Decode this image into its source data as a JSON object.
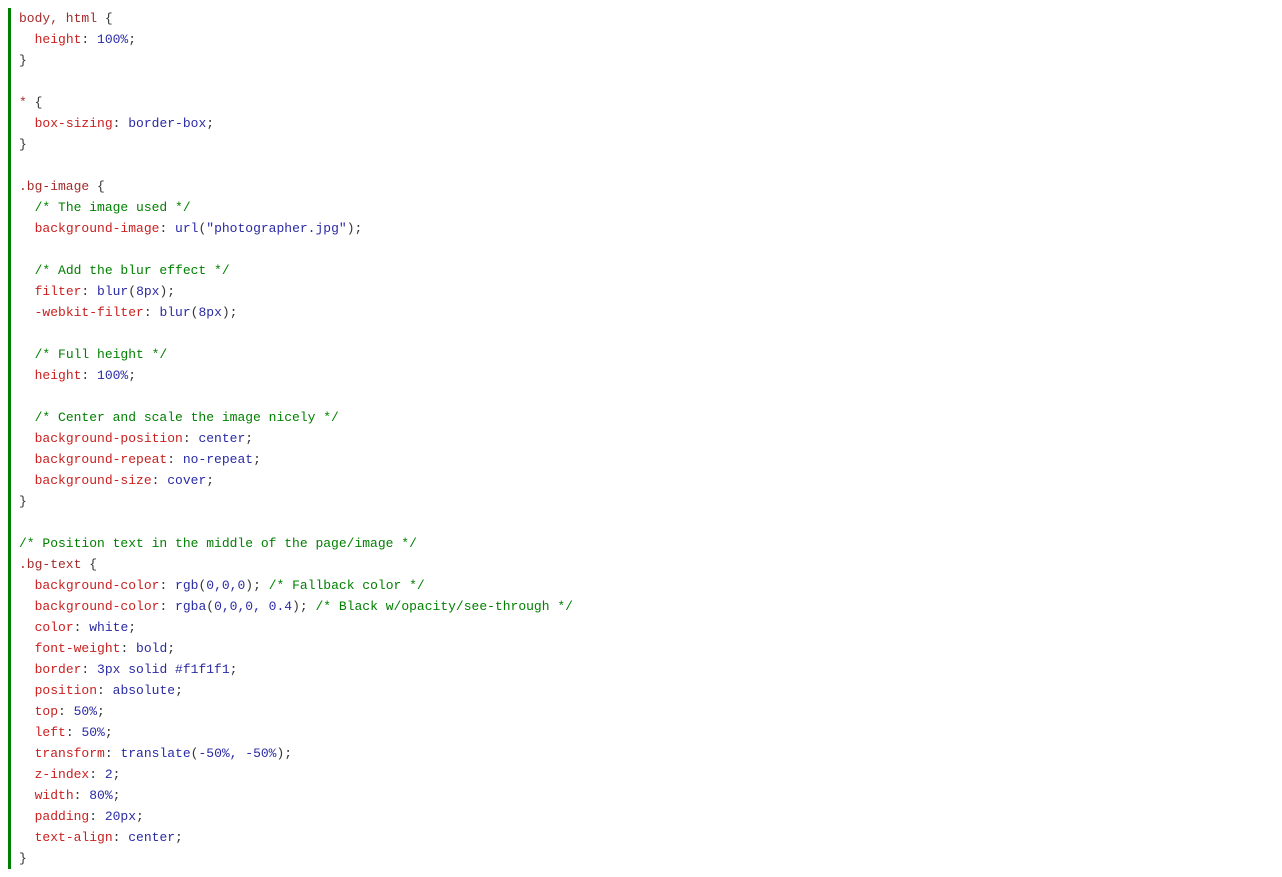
{
  "code": {
    "lines": [
      [
        {
          "cls": "t-selector",
          "text": "body, html"
        },
        {
          "cls": "t-punct",
          "text": " {"
        }
      ],
      [
        {
          "cls": "t-punct",
          "text": "  "
        },
        {
          "cls": "t-prop",
          "text": "height"
        },
        {
          "cls": "t-punct",
          "text": ": "
        },
        {
          "cls": "t-value",
          "text": "100%"
        },
        {
          "cls": "t-punct",
          "text": ";"
        }
      ],
      [
        {
          "cls": "t-punct",
          "text": "}"
        }
      ],
      [
        {
          "cls": "t-punct",
          "text": ""
        }
      ],
      [
        {
          "cls": "t-selector",
          "text": "*"
        },
        {
          "cls": "t-punct",
          "text": " {"
        }
      ],
      [
        {
          "cls": "t-punct",
          "text": "  "
        },
        {
          "cls": "t-prop",
          "text": "box-sizing"
        },
        {
          "cls": "t-punct",
          "text": ": "
        },
        {
          "cls": "t-value",
          "text": "border-box"
        },
        {
          "cls": "t-punct",
          "text": ";"
        }
      ],
      [
        {
          "cls": "t-punct",
          "text": "}"
        }
      ],
      [
        {
          "cls": "t-punct",
          "text": ""
        }
      ],
      [
        {
          "cls": "t-selector",
          "text": ".bg-image"
        },
        {
          "cls": "t-punct",
          "text": " {"
        }
      ],
      [
        {
          "cls": "t-punct",
          "text": "  "
        },
        {
          "cls": "t-comment",
          "text": "/* The image used */"
        }
      ],
      [
        {
          "cls": "t-punct",
          "text": "  "
        },
        {
          "cls": "t-prop",
          "text": "background-image"
        },
        {
          "cls": "t-punct",
          "text": ": "
        },
        {
          "cls": "t-value",
          "text": "url"
        },
        {
          "cls": "t-punct",
          "text": "("
        },
        {
          "cls": "t-string",
          "text": "\"photographer.jpg\""
        },
        {
          "cls": "t-punct",
          "text": ");"
        }
      ],
      [
        {
          "cls": "t-punct",
          "text": ""
        }
      ],
      [
        {
          "cls": "t-punct",
          "text": "  "
        },
        {
          "cls": "t-comment",
          "text": "/* Add the blur effect */"
        }
      ],
      [
        {
          "cls": "t-punct",
          "text": "  "
        },
        {
          "cls": "t-prop",
          "text": "filter"
        },
        {
          "cls": "t-punct",
          "text": ": "
        },
        {
          "cls": "t-value",
          "text": "blur"
        },
        {
          "cls": "t-punct",
          "text": "("
        },
        {
          "cls": "t-value",
          "text": "8px"
        },
        {
          "cls": "t-punct",
          "text": ");"
        }
      ],
      [
        {
          "cls": "t-punct",
          "text": "  "
        },
        {
          "cls": "t-prop",
          "text": "-webkit-filter"
        },
        {
          "cls": "t-punct",
          "text": ": "
        },
        {
          "cls": "t-value",
          "text": "blur"
        },
        {
          "cls": "t-punct",
          "text": "("
        },
        {
          "cls": "t-value",
          "text": "8px"
        },
        {
          "cls": "t-punct",
          "text": ");"
        }
      ],
      [
        {
          "cls": "t-punct",
          "text": ""
        }
      ],
      [
        {
          "cls": "t-punct",
          "text": "  "
        },
        {
          "cls": "t-comment",
          "text": "/* Full height */"
        }
      ],
      [
        {
          "cls": "t-punct",
          "text": "  "
        },
        {
          "cls": "t-prop",
          "text": "height"
        },
        {
          "cls": "t-punct",
          "text": ": "
        },
        {
          "cls": "t-value",
          "text": "100%"
        },
        {
          "cls": "t-punct",
          "text": ";"
        }
      ],
      [
        {
          "cls": "t-punct",
          "text": ""
        }
      ],
      [
        {
          "cls": "t-punct",
          "text": "  "
        },
        {
          "cls": "t-comment",
          "text": "/* Center and scale the image nicely */"
        }
      ],
      [
        {
          "cls": "t-punct",
          "text": "  "
        },
        {
          "cls": "t-prop",
          "text": "background-position"
        },
        {
          "cls": "t-punct",
          "text": ": "
        },
        {
          "cls": "t-value",
          "text": "center"
        },
        {
          "cls": "t-punct",
          "text": ";"
        }
      ],
      [
        {
          "cls": "t-punct",
          "text": "  "
        },
        {
          "cls": "t-prop",
          "text": "background-repeat"
        },
        {
          "cls": "t-punct",
          "text": ": "
        },
        {
          "cls": "t-value",
          "text": "no-repeat"
        },
        {
          "cls": "t-punct",
          "text": ";"
        }
      ],
      [
        {
          "cls": "t-punct",
          "text": "  "
        },
        {
          "cls": "t-prop",
          "text": "background-size"
        },
        {
          "cls": "t-punct",
          "text": ": "
        },
        {
          "cls": "t-value",
          "text": "cover"
        },
        {
          "cls": "t-punct",
          "text": ";"
        }
      ],
      [
        {
          "cls": "t-punct",
          "text": "}"
        }
      ],
      [
        {
          "cls": "t-punct",
          "text": ""
        }
      ],
      [
        {
          "cls": "t-comment",
          "text": "/* Position text in the middle of the page/image */"
        }
      ],
      [
        {
          "cls": "t-selector",
          "text": ".bg-text"
        },
        {
          "cls": "t-punct",
          "text": " {"
        }
      ],
      [
        {
          "cls": "t-punct",
          "text": "  "
        },
        {
          "cls": "t-prop",
          "text": "background-color"
        },
        {
          "cls": "t-punct",
          "text": ": "
        },
        {
          "cls": "t-value",
          "text": "rgb"
        },
        {
          "cls": "t-punct",
          "text": "("
        },
        {
          "cls": "t-value",
          "text": "0,0,0"
        },
        {
          "cls": "t-punct",
          "text": "); "
        },
        {
          "cls": "t-comment",
          "text": "/* Fallback color */"
        }
      ],
      [
        {
          "cls": "t-punct",
          "text": "  "
        },
        {
          "cls": "t-prop",
          "text": "background-color"
        },
        {
          "cls": "t-punct",
          "text": ": "
        },
        {
          "cls": "t-value",
          "text": "rgba"
        },
        {
          "cls": "t-punct",
          "text": "("
        },
        {
          "cls": "t-value",
          "text": "0,0,0, 0.4"
        },
        {
          "cls": "t-punct",
          "text": "); "
        },
        {
          "cls": "t-comment",
          "text": "/* Black w/opacity/see-through */"
        }
      ],
      [
        {
          "cls": "t-punct",
          "text": "  "
        },
        {
          "cls": "t-prop",
          "text": "color"
        },
        {
          "cls": "t-punct",
          "text": ": "
        },
        {
          "cls": "t-value",
          "text": "white"
        },
        {
          "cls": "t-punct",
          "text": ";"
        }
      ],
      [
        {
          "cls": "t-punct",
          "text": "  "
        },
        {
          "cls": "t-prop",
          "text": "font-weight"
        },
        {
          "cls": "t-punct",
          "text": ": "
        },
        {
          "cls": "t-value",
          "text": "bold"
        },
        {
          "cls": "t-punct",
          "text": ";"
        }
      ],
      [
        {
          "cls": "t-punct",
          "text": "  "
        },
        {
          "cls": "t-prop",
          "text": "border"
        },
        {
          "cls": "t-punct",
          "text": ": "
        },
        {
          "cls": "t-value",
          "text": "3px solid #f1f1f1"
        },
        {
          "cls": "t-punct",
          "text": ";"
        }
      ],
      [
        {
          "cls": "t-punct",
          "text": "  "
        },
        {
          "cls": "t-prop",
          "text": "position"
        },
        {
          "cls": "t-punct",
          "text": ": "
        },
        {
          "cls": "t-value",
          "text": "absolute"
        },
        {
          "cls": "t-punct",
          "text": ";"
        }
      ],
      [
        {
          "cls": "t-punct",
          "text": "  "
        },
        {
          "cls": "t-prop",
          "text": "top"
        },
        {
          "cls": "t-punct",
          "text": ": "
        },
        {
          "cls": "t-value",
          "text": "50%"
        },
        {
          "cls": "t-punct",
          "text": ";"
        }
      ],
      [
        {
          "cls": "t-punct",
          "text": "  "
        },
        {
          "cls": "t-prop",
          "text": "left"
        },
        {
          "cls": "t-punct",
          "text": ": "
        },
        {
          "cls": "t-value",
          "text": "50%"
        },
        {
          "cls": "t-punct",
          "text": ";"
        }
      ],
      [
        {
          "cls": "t-punct",
          "text": "  "
        },
        {
          "cls": "t-prop",
          "text": "transform"
        },
        {
          "cls": "t-punct",
          "text": ": "
        },
        {
          "cls": "t-value",
          "text": "translate"
        },
        {
          "cls": "t-punct",
          "text": "("
        },
        {
          "cls": "t-value",
          "text": "-50%, -50%"
        },
        {
          "cls": "t-punct",
          "text": ");"
        }
      ],
      [
        {
          "cls": "t-punct",
          "text": "  "
        },
        {
          "cls": "t-prop",
          "text": "z-index"
        },
        {
          "cls": "t-punct",
          "text": ": "
        },
        {
          "cls": "t-value",
          "text": "2"
        },
        {
          "cls": "t-punct",
          "text": ";"
        }
      ],
      [
        {
          "cls": "t-punct",
          "text": "  "
        },
        {
          "cls": "t-prop",
          "text": "width"
        },
        {
          "cls": "t-punct",
          "text": ": "
        },
        {
          "cls": "t-value",
          "text": "80%"
        },
        {
          "cls": "t-punct",
          "text": ";"
        }
      ],
      [
        {
          "cls": "t-punct",
          "text": "  "
        },
        {
          "cls": "t-prop",
          "text": "padding"
        },
        {
          "cls": "t-punct",
          "text": ": "
        },
        {
          "cls": "t-value",
          "text": "20px"
        },
        {
          "cls": "t-punct",
          "text": ";"
        }
      ],
      [
        {
          "cls": "t-punct",
          "text": "  "
        },
        {
          "cls": "t-prop",
          "text": "text-align"
        },
        {
          "cls": "t-punct",
          "text": ": "
        },
        {
          "cls": "t-value",
          "text": "center"
        },
        {
          "cls": "t-punct",
          "text": ";"
        }
      ],
      [
        {
          "cls": "t-punct",
          "text": "}"
        }
      ]
    ]
  }
}
